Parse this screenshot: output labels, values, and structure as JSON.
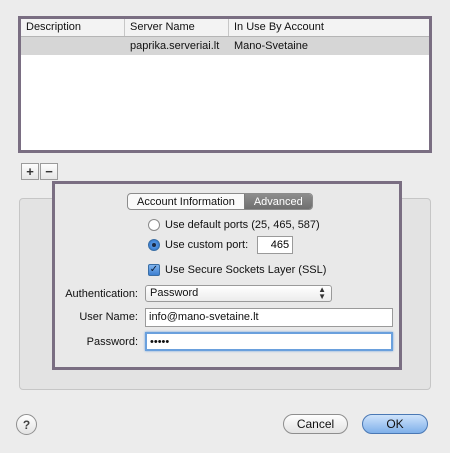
{
  "server_list": {
    "columns": [
      "Description",
      "Server Name",
      "In Use By Account"
    ],
    "rows": [
      {
        "description": "",
        "server_name": "paprika.serveriai.lt",
        "in_use_by": "Mano-Svetaine"
      }
    ]
  },
  "list_controls": {
    "add": "+",
    "remove": "−"
  },
  "tabs": {
    "account_information": "Account Information",
    "advanced": "Advanced"
  },
  "ports": {
    "default_label": "Use default ports (25, 465, 587)",
    "custom_label": "Use custom port:",
    "custom_value": "465",
    "selected": "custom"
  },
  "ssl": {
    "label": "Use Secure Sockets Layer (SSL)",
    "checked": true
  },
  "authentication": {
    "label": "Authentication:",
    "value": "Password"
  },
  "user_name": {
    "label": "User Name:",
    "value": "info@mano-svetaine.lt"
  },
  "password": {
    "label": "Password:",
    "value": "•••••"
  },
  "footer": {
    "help": "?",
    "cancel": "Cancel",
    "ok": "OK"
  }
}
